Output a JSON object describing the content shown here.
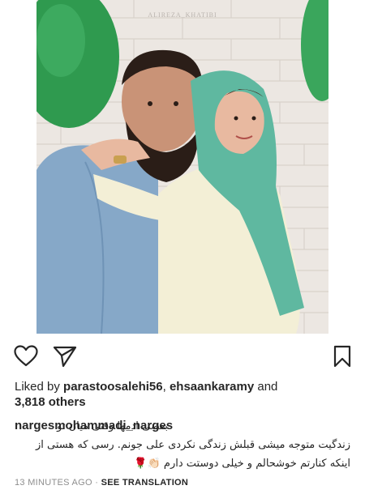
{
  "post": {
    "photo_watermark": "ALIREZA_KHATIBI",
    "icons": {
      "like": "heart-icon",
      "share": "paper-plane-icon",
      "save": "bookmark-icon"
    },
    "likes": {
      "prefix": "Liked by ",
      "user1": "parastoosalehi56",
      "separator": ", ",
      "user2": "ehsaankaramy",
      "conjunction": " and",
      "others": "3,818 others"
    },
    "caption": {
      "username": "nargesmohammadi_narges",
      "line1": "بعضی ادمها وقتی میان تو",
      "line2": "زندگیت متوجه میشی قبلش زندگی نکردی علی جونم. رسی که هستی از",
      "line3": "اینکه کنارتم خوشحالم و خیلی دوستت دارم",
      "emoji": "👏🏻🌹"
    },
    "timestamp": "13 MINUTES AGO",
    "dot": " · ",
    "see_translation": "SEE TRANSLATION"
  }
}
